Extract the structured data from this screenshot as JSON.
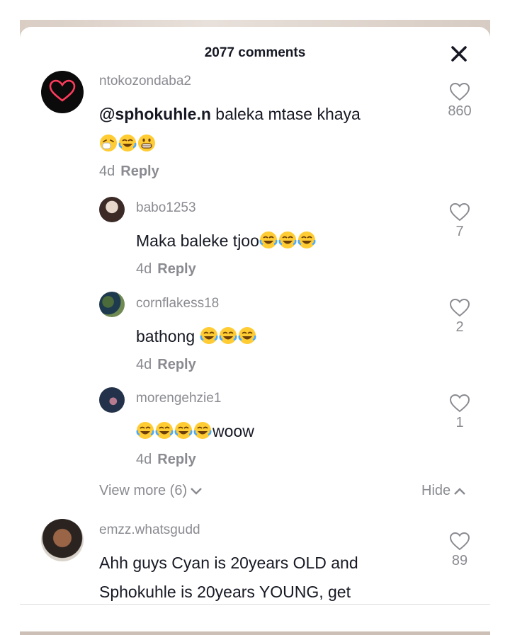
{
  "header": {
    "title": "2077 comments"
  },
  "comments": [
    {
      "username": "ntokozondaba2",
      "mention": "@sphokuhle.n",
      "text": "baleka mtase khaya",
      "emojis": [
        "sneeze",
        "joy",
        "grin"
      ],
      "time": "4d",
      "reply": "Reply",
      "likes": "860",
      "avatar": "heart-avatar"
    },
    {
      "username": "babo1253",
      "text": "Maka baleke tjoo",
      "emojis": [
        "joy",
        "joy",
        "joy"
      ],
      "time": "4d",
      "reply": "Reply",
      "likes": "7",
      "avatar": "photo-avatar"
    },
    {
      "username": "cornflakess18",
      "text": "bathong ",
      "emojis": [
        "joy",
        "joy",
        "joy"
      ],
      "time": "4d",
      "reply": "Reply",
      "likes": "2",
      "avatar": "photo-avatar"
    },
    {
      "username": "morengehzie1",
      "text": "woow",
      "emojis": [
        "joy",
        "joy",
        "joy",
        "joy"
      ],
      "time": "4d",
      "reply": "Reply",
      "likes": "1",
      "avatar": "photo-avatar"
    },
    {
      "username": "emzz.whatsgudd",
      "line1": "Ahh guys Cyan is 20years OLD and",
      "line2": "Sphokuhle is 20years YOUNG, get",
      "likes": "89",
      "avatar": "photo-avatar"
    }
  ],
  "thread_controls": {
    "view_more": "View more (6)",
    "hide": "Hide"
  },
  "colors": {
    "text": "#161823",
    "muted": "#8a8b91",
    "emoji_face": "#ffcc33"
  },
  "icons": [
    "close-icon",
    "heart-outline-icon",
    "chevron-down-icon",
    "chevron-up-icon"
  ]
}
